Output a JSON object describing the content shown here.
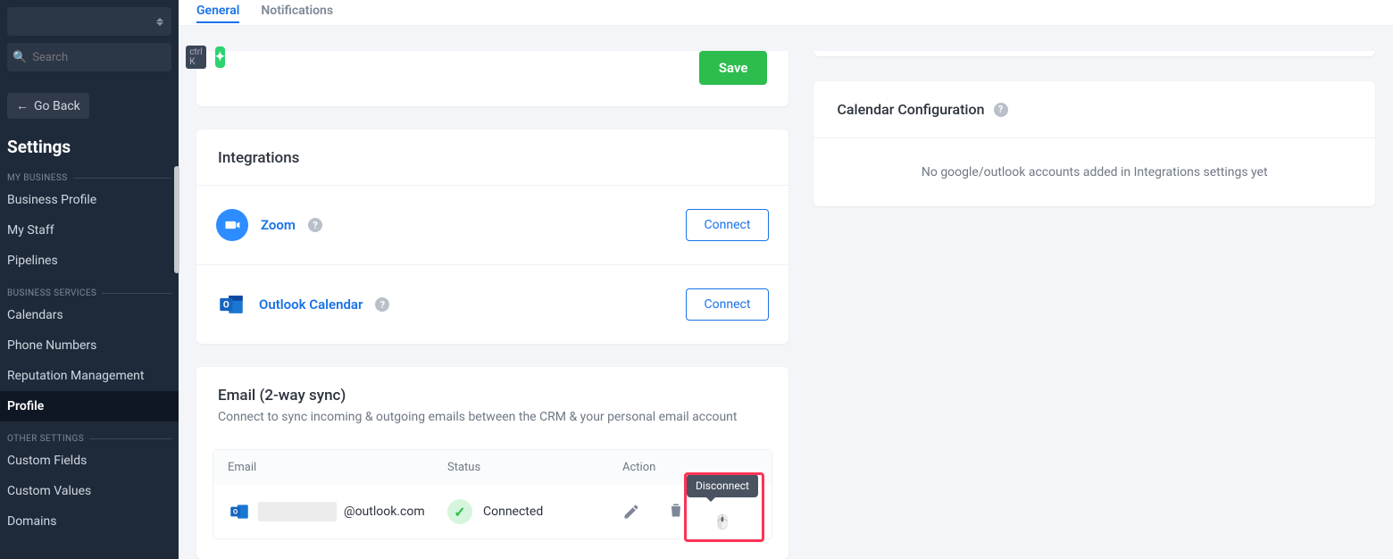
{
  "sidebar": {
    "search_placeholder": "Search",
    "kbd": "ctrl K",
    "go_back": "Go Back",
    "title": "Settings",
    "groups": [
      {
        "label": "MY BUSINESS",
        "items": [
          "Business Profile",
          "My Staff",
          "Pipelines"
        ]
      },
      {
        "label": "BUSINESS SERVICES",
        "items": [
          "Calendars",
          "Phone Numbers",
          "Reputation Management",
          "Profile"
        ]
      },
      {
        "label": "OTHER SETTINGS",
        "items": [
          "Custom Fields",
          "Custom Values",
          "Domains"
        ]
      }
    ],
    "active_item": "Profile"
  },
  "tabs": {
    "items": [
      "General",
      "Notifications"
    ],
    "active": "General"
  },
  "save_button": "Save",
  "integrations": {
    "title": "Integrations",
    "rows": [
      {
        "name": "Zoom",
        "action": "Connect"
      },
      {
        "name": "Outlook Calendar",
        "action": "Connect"
      }
    ]
  },
  "email_sync": {
    "title": "Email (2-way sync)",
    "subtitle": "Connect to sync incoming & outgoing emails between the CRM & your personal email account",
    "columns": {
      "email": "Email",
      "status": "Status",
      "action": "Action"
    },
    "row": {
      "email_suffix": "@outlook.com",
      "status": "Connected",
      "tooltip": "Disconnect"
    }
  },
  "calendar": {
    "title": "Calendar Configuration",
    "empty": "No google/outlook accounts added in Integrations settings yet"
  }
}
